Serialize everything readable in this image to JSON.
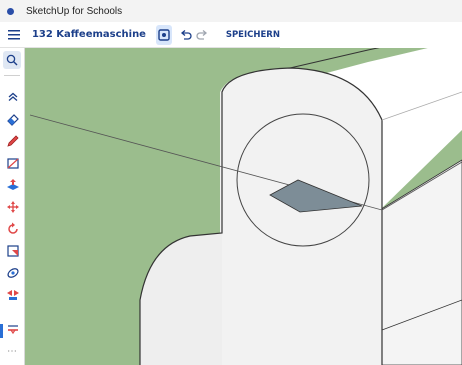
{
  "window": {
    "title": "SketchUp for Schools"
  },
  "toolbar": {
    "model_name": "132 Kaffeemaschine",
    "save_label": "SPEICHERN"
  },
  "tools": [
    "search-icon",
    "collapse-icon",
    "eraser-icon",
    "pencil-icon",
    "rectangle-icon",
    "push-pull-icon",
    "move-icon",
    "rotate-icon",
    "scale-icon",
    "orbit-icon",
    "flip-icon",
    "section-plane-icon",
    "more-icon"
  ],
  "colors": {
    "background_green": "#9bbd8d",
    "model_face": "#f2f2f2",
    "model_shade": "#e4e4e4",
    "selected_face": "#7d8d97",
    "accent_blue": "#1c3f8a"
  },
  "more_label": "⋯"
}
